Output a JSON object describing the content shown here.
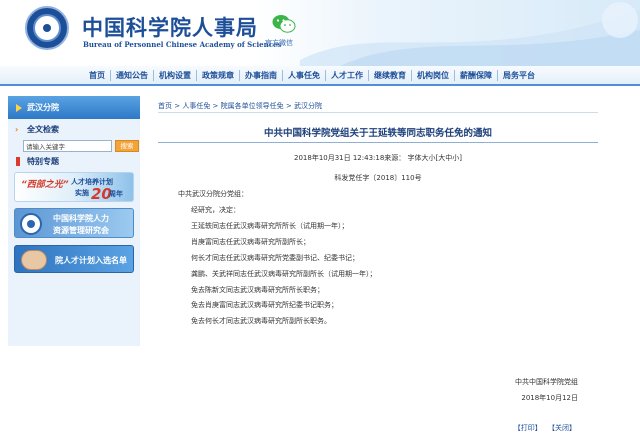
{
  "header": {
    "title": "中国科学院人事局",
    "subtitle": "Bureau of Personnel Chinese Academy of Sciences",
    "wechat_label": "官方微信"
  },
  "nav": {
    "items": [
      "首页",
      "通知公告",
      "机构设置",
      "政策规章",
      "办事指南",
      "人事任免",
      "人才工作",
      "继续教育",
      "机构岗位",
      "薪酬保障",
      "局务平台"
    ]
  },
  "sidebar": {
    "section_head": "武汉分院",
    "search_title": "全文检索",
    "search_placeholder": "请输入关键字",
    "search_button": "搜索",
    "special_title": "特别专题",
    "banner1": {
      "a": "“西部之光”",
      "b": "人才培养计划",
      "c": "实施",
      "d": "20",
      "e": "周年"
    },
    "banner2": {
      "l1": "中国科学院人力",
      "l2": "资源管理研究会"
    },
    "banner3": "院人才计划入选名单"
  },
  "breadcrumb": "首页 > 人事任免 > 院属各单位领导任免 > 武汉分院",
  "article": {
    "title": "中共中国科学院党组关于王延轶等同志职务任免的通知",
    "meta": "2018年10月31日 12:43:18来源：    字体大小[大中小]",
    "doc_number": "科发党任字〔2018〕110号",
    "salutation": "中共武汉分院分党组：",
    "paragraphs": [
      "经研究，决定：",
      "王延轶同志任武汉病毒研究所所长（试用期一年）；",
      "肖庚富同志任武汉病毒研究所副所长；",
      "何长才同志任武汉病毒研究所党委副书记、纪委书记；",
      "龚鹏、关武祥同志任武汉病毒研究所副所长（试用期一年）；",
      "免去陈新文同志武汉病毒研究所所长职务；",
      "免去肖庚富同志武汉病毒研究所纪委书记职务；",
      "免去何长才同志武汉病毒研究所副所长职务。"
    ],
    "signer": "中共中国科学院党组",
    "sign_date": "2018年10月12日",
    "print_label": "【打印】",
    "close_label": "【关闭】"
  }
}
